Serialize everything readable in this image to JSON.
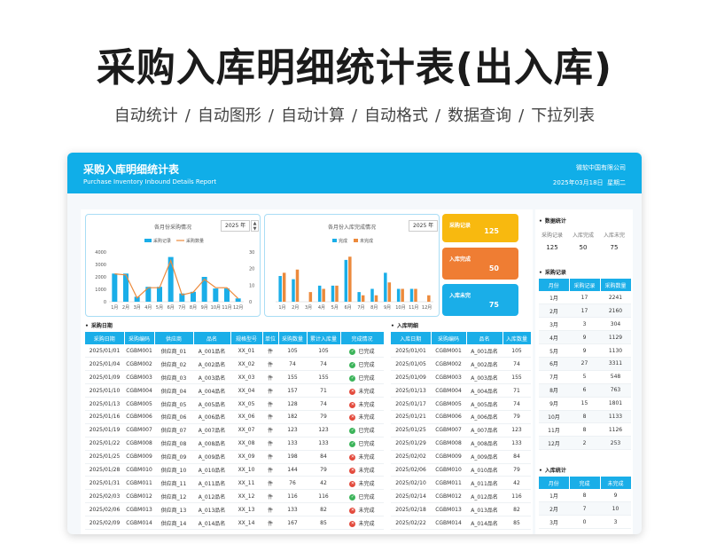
{
  "hero": {
    "title": "采购入库明细统计表(出入库)",
    "features": [
      "自动统计",
      "/",
      "自动图形",
      "/",
      "自动计算",
      "/",
      "自动格式",
      "/",
      "数据查询",
      "/",
      "下拉列表"
    ]
  },
  "sheet": {
    "title": "采购入库明细统计表",
    "subtitle": "Purchase Inventory Inbound Details Report",
    "company": "微软中国有限公司",
    "date": "2025年03月18日",
    "weekday": "星期二"
  },
  "colors": {
    "accent": "#10aee8",
    "blue": "#1aaee8",
    "orange": "#ec8a3c",
    "yellow": "#f8b90f",
    "kpi_orange": "#ef7d33",
    "kpi_blue": "#1aaee8"
  },
  "chart_data": [
    {
      "type": "bar",
      "title": "各月份采购情况",
      "year": "2025 年",
      "categories": [
        "1月",
        "2月",
        "3月",
        "4月",
        "5月",
        "6月",
        "7月",
        "8月",
        "9月",
        "10月",
        "11月",
        "12月"
      ],
      "series": [
        {
          "name": "采购记录",
          "type": "bar",
          "axis": "right",
          "values": [
            17,
            17,
            3,
            9,
            9,
            27,
            5,
            6,
            15,
            8,
            8,
            2
          ]
        },
        {
          "name": "采购数量",
          "type": "line",
          "axis": "left",
          "values": [
            2241,
            2160,
            304,
            1129,
            1130,
            3311,
            548,
            763,
            1801,
            1133,
            1126,
            253
          ]
        }
      ],
      "y_left": {
        "ticks": [
          "0",
          "1000",
          "2000",
          "3000",
          "4000"
        ],
        "range": [
          0,
          4000
        ]
      },
      "y_right": {
        "ticks": [
          "0",
          "10",
          "20",
          "30"
        ],
        "range": [
          0,
          30
        ]
      }
    },
    {
      "type": "bar",
      "title": "各月份入库完成情况",
      "year": "2025 年",
      "categories": [
        "1月",
        "2月",
        "3月",
        "4月",
        "5月",
        "6月",
        "7月",
        "8月",
        "9月",
        "10月",
        "11月",
        "12月"
      ],
      "series": [
        {
          "name": "完成",
          "values": [
            8,
            7,
            0,
            5,
            5,
            13,
            3,
            4,
            9,
            4,
            4,
            0
          ]
        },
        {
          "name": "未完成",
          "values": [
            9,
            10,
            3,
            4,
            5,
            14,
            2,
            2,
            6,
            4,
            4,
            2
          ]
        }
      ],
      "y_range": [
        0,
        16
      ]
    }
  ],
  "kpis": [
    {
      "label": "采购记录",
      "value": "125"
    },
    {
      "label": "入库完成",
      "value": "50"
    },
    {
      "label": "入库未完",
      "value": "75"
    }
  ],
  "purchase": {
    "section": "采购日期",
    "headers": [
      "采购日期",
      "采购编码",
      "供应商",
      "品名",
      "规格型号",
      "单位",
      "采购数量",
      "累计入库量",
      "完成情况"
    ],
    "rows": [
      [
        "2025/01/01",
        "CGBM001",
        "供应商_01",
        "A_001品名",
        "XX_01",
        "件",
        "105",
        "105",
        "已完成"
      ],
      [
        "2025/01/04",
        "CGBM002",
        "供应商_02",
        "A_002品名",
        "XX_02",
        "件",
        "74",
        "74",
        "已完成"
      ],
      [
        "2025/01/09",
        "CGBM003",
        "供应商_03",
        "A_003品名",
        "XX_03",
        "件",
        "155",
        "155",
        "已完成"
      ],
      [
        "2025/01/10",
        "CGBM004",
        "供应商_04",
        "A_004品名",
        "XX_04",
        "件",
        "157",
        "71",
        "未完成"
      ],
      [
        "2025/01/13",
        "CGBM005",
        "供应商_05",
        "A_005品名",
        "XX_05",
        "件",
        "128",
        "74",
        "未完成"
      ],
      [
        "2025/01/16",
        "CGBM006",
        "供应商_06",
        "A_006品名",
        "XX_06",
        "件",
        "182",
        "79",
        "未完成"
      ],
      [
        "2025/01/19",
        "CGBM007",
        "供应商_07",
        "A_007品名",
        "XX_07",
        "件",
        "123",
        "123",
        "已完成"
      ],
      [
        "2025/01/22",
        "CGBM008",
        "供应商_08",
        "A_008品名",
        "XX_08",
        "件",
        "133",
        "133",
        "已完成"
      ],
      [
        "2025/01/25",
        "CGBM009",
        "供应商_09",
        "A_009品名",
        "XX_09",
        "件",
        "198",
        "84",
        "未完成"
      ],
      [
        "2025/01/28",
        "CGBM010",
        "供应商_10",
        "A_010品名",
        "XX_10",
        "件",
        "144",
        "79",
        "未完成"
      ],
      [
        "2025/01/31",
        "CGBM011",
        "供应商_11",
        "A_011品名",
        "XX_11",
        "件",
        "76",
        "42",
        "未完成"
      ],
      [
        "2025/02/03",
        "CGBM012",
        "供应商_12",
        "A_012品名",
        "XX_12",
        "件",
        "116",
        "116",
        "已完成"
      ],
      [
        "2025/02/06",
        "CGBM013",
        "供应商_13",
        "A_013品名",
        "XX_13",
        "件",
        "133",
        "82",
        "未完成"
      ],
      [
        "2025/02/09",
        "CGBM014",
        "供应商_14",
        "A_014品名",
        "XX_14",
        "件",
        "167",
        "85",
        "未完成"
      ]
    ]
  },
  "inbound": {
    "section": "入库明细",
    "headers": [
      "入库日期",
      "采购编码",
      "品名",
      "入库数量"
    ],
    "rows": [
      [
        "2025/01/01",
        "CGBM001",
        "A_001品名",
        "105"
      ],
      [
        "2025/01/05",
        "CGBM002",
        "A_002品名",
        "74"
      ],
      [
        "2025/01/09",
        "CGBM003",
        "A_003品名",
        "155"
      ],
      [
        "2025/01/13",
        "CGBM004",
        "A_004品名",
        "71"
      ],
      [
        "2025/01/17",
        "CGBM005",
        "A_005品名",
        "74"
      ],
      [
        "2025/01/21",
        "CGBM006",
        "A_006品名",
        "79"
      ],
      [
        "2025/01/25",
        "CGBM007",
        "A_007品名",
        "123"
      ],
      [
        "2025/01/29",
        "CGBM008",
        "A_008品名",
        "133"
      ],
      [
        "2025/02/02",
        "CGBM009",
        "A_009品名",
        "84"
      ],
      [
        "2025/02/06",
        "CGBM010",
        "A_010品名",
        "79"
      ],
      [
        "2025/02/10",
        "CGBM011",
        "A_011品名",
        "42"
      ],
      [
        "2025/02/14",
        "CGBM012",
        "A_012品名",
        "116"
      ],
      [
        "2025/02/18",
        "CGBM013",
        "A_013品名",
        "82"
      ],
      [
        "2025/02/22",
        "CGBM014",
        "A_014品名",
        "85"
      ]
    ]
  },
  "side": {
    "stats_label": "数据统计",
    "stats_headers": [
      "采购记录",
      "入库完成",
      "入库未完"
    ],
    "stats_values": [
      "125",
      "50",
      "75"
    ],
    "purchase_label": "采购记录",
    "purchase_headers": [
      "月份",
      "采购记录",
      "采购数量"
    ],
    "purchase_rows": [
      [
        "1月",
        "17",
        "2241"
      ],
      [
        "2月",
        "17",
        "2160"
      ],
      [
        "3月",
        "3",
        "304"
      ],
      [
        "4月",
        "9",
        "1129"
      ],
      [
        "5月",
        "9",
        "1130"
      ],
      [
        "6月",
        "27",
        "3311"
      ],
      [
        "7月",
        "5",
        "548"
      ],
      [
        "8月",
        "6",
        "763"
      ],
      [
        "9月",
        "15",
        "1801"
      ],
      [
        "10月",
        "8",
        "1133"
      ],
      [
        "11月",
        "8",
        "1126"
      ],
      [
        "12月",
        "2",
        "253"
      ]
    ],
    "inbound_label": "入库统计",
    "inbound_headers": [
      "月份",
      "完成",
      "未完成"
    ],
    "inbound_rows": [
      [
        "1月",
        "8",
        "9"
      ],
      [
        "2月",
        "7",
        "10"
      ],
      [
        "3月",
        "0",
        "3"
      ]
    ]
  }
}
